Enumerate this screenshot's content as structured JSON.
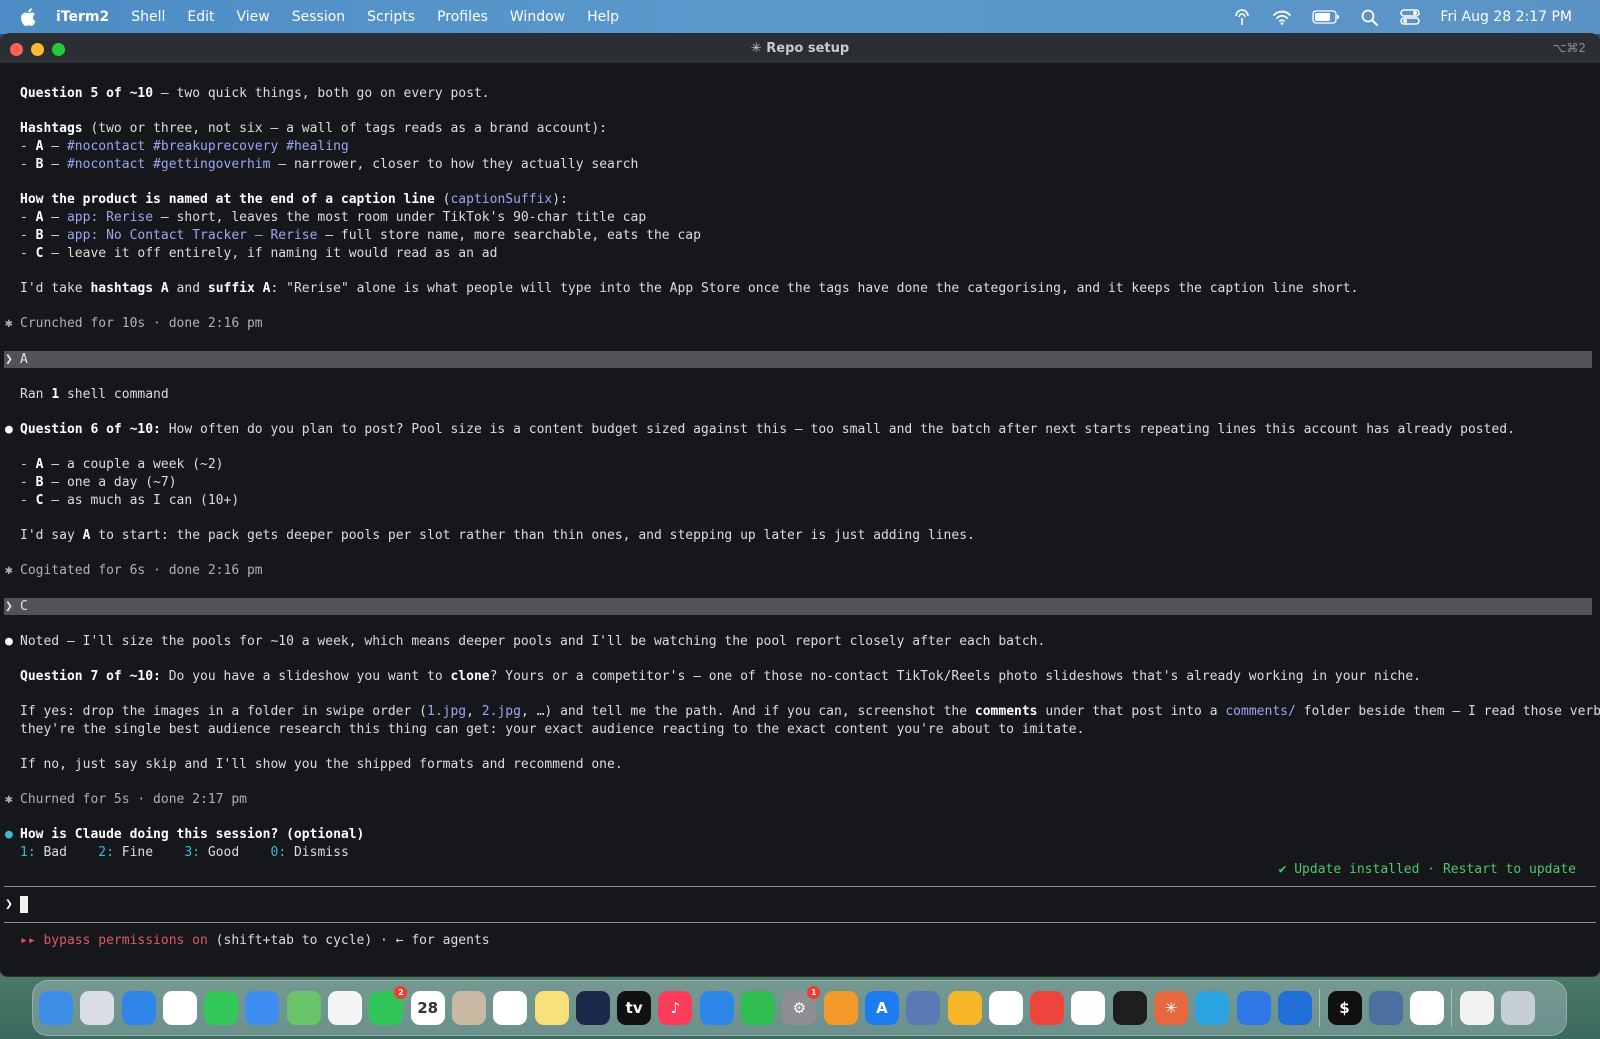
{
  "menubar": {
    "app_name": "iTerm2",
    "items": [
      "Shell",
      "Edit",
      "View",
      "Session",
      "Scripts",
      "Profiles",
      "Window",
      "Help"
    ],
    "clock": "Fri Aug 28  2:17 PM",
    "icons": [
      "airdrop-icon",
      "wifi-icon",
      "battery-icon",
      "spotlight-icon",
      "control-center-icon"
    ]
  },
  "window": {
    "title": "✳ Repo setup",
    "shortcut": "⌥⌘2"
  },
  "terminal": {
    "q5_head_bold": "Question 5 of ~10",
    "q5_head_rest": " – two quick things, both go on every post.",
    "hashtags_bold": "Hashtags",
    "hashtags_rest": " (two or three, not six – a wall of tags reads as a brand account):",
    "hashA_pre": "- ",
    "hashA_key": "A",
    "hashA_sep": " – ",
    "hashA_tags": "#nocontact #breakuprecovery #healing",
    "hashB_key": "B",
    "hashB_tags": "#nocontact #gettingoverhim",
    "hashB_rest": " – narrower, closer to how they actually search",
    "suffix_bold": "How the product is named at the end of a caption line",
    "suffix_open": " (",
    "suffix_code": "captionSuffix",
    "suffix_close": "):",
    "sufA_key": "A",
    "sufA_code": "app: Rerise",
    "sufA_rest": " – short, leaves the most room under TikTok's 90-char title cap",
    "sufB_key": "B",
    "sufB_code": "app: No Contact Tracker – Rerise",
    "sufB_rest": " – full store name, more searchable, eats the cap",
    "sufC_key": "C",
    "sufC_rest": " – leave it off entirely, if naming it would read as an ad",
    "take_pre": "I'd take ",
    "take_b1": "hashtags A",
    "take_mid": " and ",
    "take_b2": "suffix A",
    "take_rest": ": \"Rerise\" alone is what people will type into the App Store once the tags have done the categorising, and it keeps the caption line short.",
    "status1": "Crunched for 10s · done 2:16 pm",
    "user1": "A",
    "ran_pre": "Ran ",
    "ran_num": "1",
    "ran_rest": " shell command",
    "q6_bold": "Question 6 of ~10:",
    "q6_rest": " How often do you plan to post? Pool size is a content budget sized against this – too small and the batch after next starts repeating lines this account has already posted.",
    "q6A_key": "A",
    "q6A_rest": " – a couple a week (~2)",
    "q6B_key": "B",
    "q6B_rest": " – one a day (~7)",
    "q6C_key": "C",
    "q6C_rest": " – as much as I can (10+)",
    "say_pre": "I'd say ",
    "say_b": "A",
    "say_rest": " to start: the pack gets deeper pools per slot rather than thin ones, and stepping up later is just adding lines.",
    "status2": "Cogitated for 6s · done 2:16 pm",
    "user2": "C",
    "noted": "Noted – I'll size the pools for ~10 a week, which means deeper pools and I'll be watching the pool report closely after each batch.",
    "q7_bold": "Question 7 of ~10:",
    "q7_mid": " Do you have a slideshow you want to ",
    "q7_clone": "clone",
    "q7_rest": "? Yours or a competitor's – one of those no-contact TikTok/Reels photo slideshows that's already working in your niche.",
    "ifyes_pre": "If yes: drop the images in a folder in swipe order (",
    "ifyes_c1": "1.jpg",
    "ifyes_comma": ", ",
    "ifyes_c2": "2.jpg",
    "ifyes_mid1": ", …) and tell me the path. And if you can, screenshot the ",
    "ifyes_b": "comments",
    "ifyes_mid2": " under that post into a ",
    "ifyes_c3": "comments/",
    "ifyes_rest": " folder beside them – I read those verbatim, and",
    "ifyes_line2": "they're the single best audience research this thing can get: your exact audience reacting to the exact content you're about to imitate.",
    "ifno": "If no, just say skip and I'll show you the shipped formats and recommend one.",
    "status3": "Churned for 5s · done 2:17 pm",
    "feedback_q": "How is Claude doing this session? (optional)",
    "rating_options": [
      {
        "num": "1:",
        "label": " Bad"
      },
      {
        "num": "2:",
        "label": " Fine"
      },
      {
        "num": "3:",
        "label": " Good"
      },
      {
        "num": "0:",
        "label": " Dismiss"
      }
    ],
    "update_notice": "✔ Update installed · Restart to update",
    "prompt_symbol": "❯",
    "bypass_label": "▸▸ bypass permissions on",
    "bypass_hint": " (shift+tab to cycle) · ← for agents"
  },
  "dock": {
    "apps": [
      {
        "name": "finder-icon",
        "color": "#3e8ee8",
        "glyph": ""
      },
      {
        "name": "launchpad-icon",
        "color": "#d8dde6",
        "glyph": ""
      },
      {
        "name": "safari-icon",
        "color": "#2f86e8",
        "glyph": ""
      },
      {
        "name": "opera-icon",
        "color": "#ffffff",
        "glyph": ""
      },
      {
        "name": "messages-icon",
        "color": "#34c759",
        "glyph": ""
      },
      {
        "name": "mail-icon",
        "color": "#3d8ef0",
        "glyph": ""
      },
      {
        "name": "maps-icon",
        "color": "#6cc46a",
        "glyph": ""
      },
      {
        "name": "photos-icon",
        "color": "#f5f5f5",
        "glyph": ""
      },
      {
        "name": "facetime-icon",
        "color": "#32c55a",
        "glyph": "",
        "badge": "2"
      },
      {
        "name": "calendar-icon",
        "color": "#ffffff",
        "glyph": "28"
      },
      {
        "name": "contacts-icon",
        "color": "#c9b9a3",
        "glyph": ""
      },
      {
        "name": "reminders-icon",
        "color": "#ffffff",
        "glyph": ""
      },
      {
        "name": "notes-icon",
        "color": "#f8e07a",
        "glyph": ""
      },
      {
        "name": "freeform-icon",
        "color": "#1b2a4a",
        "glyph": ""
      },
      {
        "name": "appletv-icon",
        "color": "#111111",
        "glyph": "tv"
      },
      {
        "name": "music-icon",
        "color": "#fb3c5a",
        "glyph": "♪"
      },
      {
        "name": "keynote-icon",
        "color": "#2c86e8",
        "glyph": ""
      },
      {
        "name": "numbers-icon",
        "color": "#2ebd4e",
        "glyph": ""
      },
      {
        "name": "system-settings-icon",
        "color": "#8e8e93",
        "glyph": "⚙",
        "badge": "1"
      },
      {
        "name": "pages-icon",
        "color": "#f49a2a",
        "glyph": ""
      },
      {
        "name": "app-store-icon",
        "color": "#1c7cf0",
        "glyph": "A"
      },
      {
        "name": "simulator-icon",
        "color": "#5a7ab5",
        "glyph": ""
      },
      {
        "name": "sketch-icon",
        "color": "#f7b528",
        "glyph": ""
      },
      {
        "name": "vscode-icon",
        "color": "#ffffff",
        "glyph": ""
      },
      {
        "name": "anydesk-icon",
        "color": "#ef443b",
        "glyph": ""
      },
      {
        "name": "chatgpt-icon",
        "color": "#ffffff",
        "glyph": ""
      },
      {
        "name": "figma-icon",
        "color": "#1e1e1e",
        "glyph": ""
      },
      {
        "name": "claude-icon",
        "color": "#e7673f",
        "glyph": "✳"
      },
      {
        "name": "telegram-icon",
        "color": "#2aa3e0",
        "glyph": ""
      },
      {
        "name": "proton-vpn-icon",
        "color": "#2e79e6",
        "glyph": ""
      },
      {
        "name": "xcode-icon",
        "color": "#1f6fd6",
        "glyph": ""
      },
      {
        "name": "iterm-icon",
        "color": "#101010",
        "glyph": "$"
      },
      {
        "name": "migration-icon",
        "color": "#4a6fa0",
        "glyph": ""
      },
      {
        "name": "chrome-icon",
        "color": "#ffffff",
        "glyph": ""
      },
      {
        "name": "document-icon",
        "color": "#f2f2f2",
        "glyph": ""
      },
      {
        "name": "trash-icon",
        "color": "#c8ced6",
        "glyph": ""
      }
    ]
  }
}
